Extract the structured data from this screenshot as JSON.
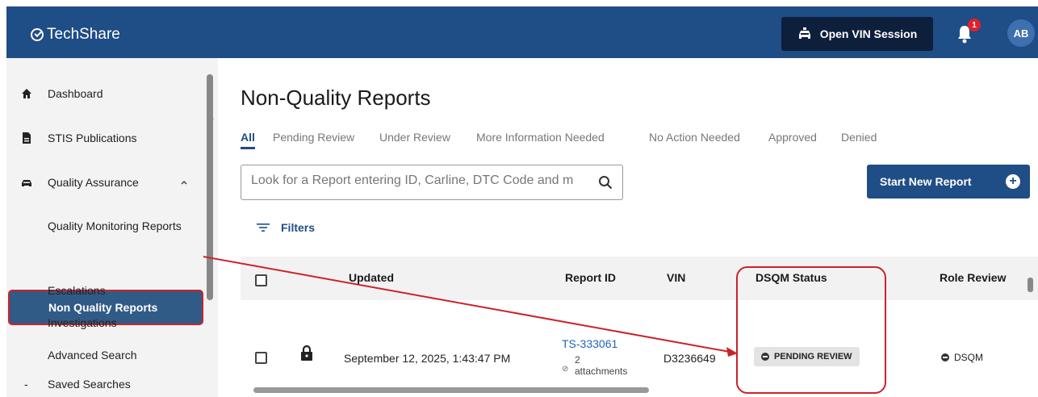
{
  "header": {
    "app_name": "TechShare",
    "vin_button": "Open VIN Session",
    "notification_count": "1",
    "avatar_initials": "AB"
  },
  "sidebar": {
    "items": [
      {
        "label": "Dashboard",
        "icon": "home-icon"
      },
      {
        "label": "STIS Publications",
        "icon": "document-icon"
      },
      {
        "label": "Quality Assurance",
        "icon": "car-icon"
      }
    ],
    "sub_items": [
      "Quality Monitoring Reports",
      "Non Quality Reports",
      "Escalations",
      "Investigations",
      "Advanced Search"
    ],
    "active_item": "Non Quality Reports",
    "saved_searches": "Saved Searches"
  },
  "main": {
    "title": "Non-Quality Reports",
    "tabs": [
      "All",
      "Pending Review",
      "Under Review",
      "More Information Needed",
      "No Action Needed",
      "Approved",
      "Denied"
    ],
    "active_tab": "All",
    "search_placeholder": "Look for a Report entering ID, Carline, DTC Code and m",
    "start_button": "Start New Report",
    "filters_label": "Filters"
  },
  "table": {
    "columns": [
      "Updated",
      "Report ID",
      "VIN",
      "DSQM Status",
      "Role Review"
    ],
    "rows": [
      {
        "updated": "September 12, 2025, 1:43:47 PM",
        "report_id": "TS-333061",
        "attachments_count": "2",
        "attachments_label": "attachments",
        "vin": "D3236649",
        "dsqm_status": "PENDING REVIEW",
        "role_review": "DSQM"
      }
    ]
  },
  "colors": {
    "header": "#1f4d86",
    "primary": "#1f4d86",
    "highlight": "#cc2229"
  }
}
